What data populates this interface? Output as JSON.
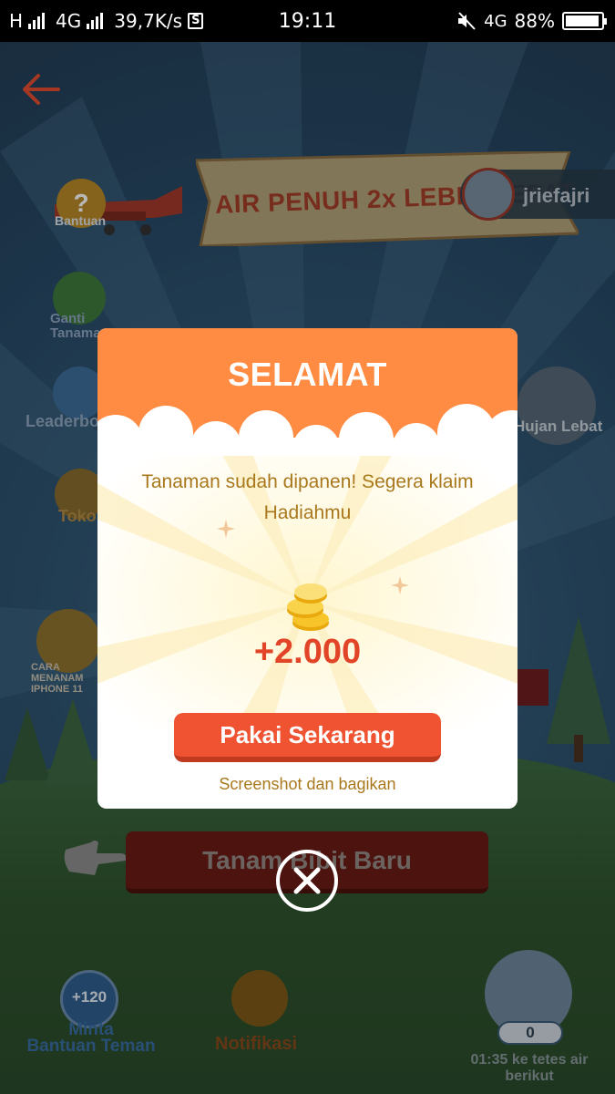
{
  "status_bar": {
    "network_left": "H",
    "network_type": "4G",
    "speed": "39,7K/s",
    "s_badge": "S",
    "time": "19:11",
    "network_right": "4G",
    "battery": "88%"
  },
  "game": {
    "banner_text": "AIR PENUH 2x LEBIH CEPAT",
    "help_label": "Bantuan",
    "username": "jriefajri",
    "side_menu": [
      {
        "label": "Ganti Tanaman",
        "icon": "swap-icon"
      },
      {
        "label": "Leaderboard",
        "icon": "podium-icon"
      },
      {
        "label": "Toko",
        "icon": "shop-icon"
      },
      {
        "label": "CARA MENANAM IPHONE 11",
        "icon": "phone-icon"
      }
    ],
    "rain_label": "Hujan Lebat",
    "plant_button": "Tanam Bibit Baru",
    "bottom_bar": {
      "help_friend_badge": "+120",
      "help_friend_label_1": "Minta",
      "help_friend_label_2": "Bantuan Teman",
      "notif_label": "Notifikasi",
      "water_count": "0",
      "water_timer_1": "01:35 ke tetes air",
      "water_timer_2": "berikut"
    }
  },
  "modal": {
    "title": "SELAMAT",
    "message": "Tanaman sudah dipanen! Segera klaim Hadiahmu",
    "reward": "+2.000",
    "use_button": "Pakai Sekarang",
    "share_text": "Screenshot dan bagikan"
  },
  "colors": {
    "modal_header": "#ff8c42",
    "button": "#ef5331",
    "reward_text": "#e24428",
    "message_text": "#a9781c"
  }
}
